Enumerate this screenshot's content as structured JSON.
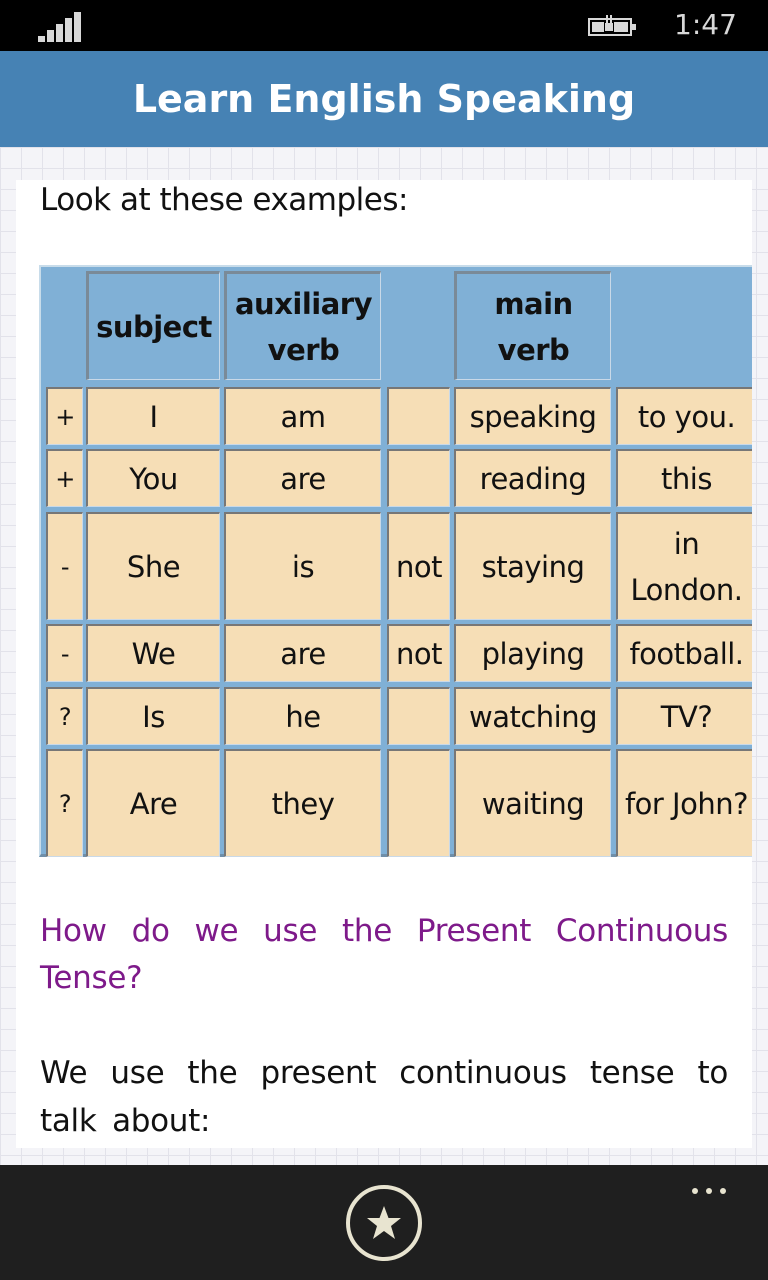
{
  "status_bar": {
    "signal_icon": "signal-strength-icon",
    "battery_icon": "battery-charging-icon",
    "time": "1:47"
  },
  "header": {
    "title": "Learn English Speaking"
  },
  "content": {
    "intro": "Look at these examples:",
    "table": {
      "headers": [
        "",
        "subject",
        "auxiliary verb",
        "",
        "main verb",
        ""
      ],
      "rows": [
        [
          "+",
          "I",
          "am",
          "",
          "speaking",
          "to you."
        ],
        [
          "+",
          "You",
          "are",
          "",
          "reading",
          "this"
        ],
        [
          "-",
          "She",
          "is",
          "not",
          "staying",
          "in London."
        ],
        [
          "-",
          "We",
          "are",
          "not",
          "playing",
          "football."
        ],
        [
          "?",
          "Is",
          "he",
          "",
          "watching",
          "TV?"
        ],
        [
          "?",
          "Are",
          "they",
          "",
          "waiting",
          "for John?"
        ]
      ]
    },
    "question": "How do we use the Present Continuous Tense?",
    "body": "We use the present continuous tense to talk about:"
  },
  "app_bar": {
    "favorite_icon": "star-icon",
    "more_icon": "ellipsis-icon"
  },
  "colors": {
    "title_bar": "#4682b4",
    "table_header": "#80b0d6",
    "table_cell": "#f6deb6",
    "question_text": "#7e1a8a",
    "app_bar": "#1f1f1f"
  }
}
